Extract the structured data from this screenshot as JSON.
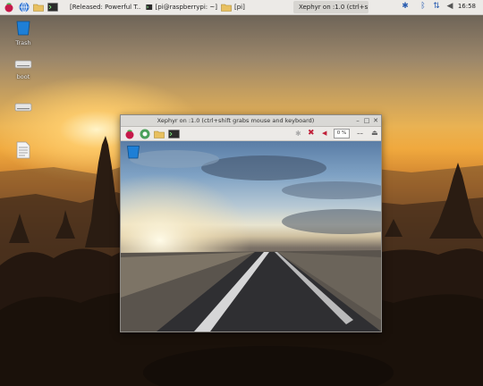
{
  "taskbar": {
    "tasks": [
      {
        "label": "[Released: Powerful T..."
      },
      {
        "label": "[pi@raspberrypi: ~]"
      },
      {
        "label": "[pi]"
      },
      {
        "label": "Xephyr on :1.0 (ctrl+s..."
      }
    ],
    "clock": "16:58"
  },
  "desktop": {
    "icons": [
      {
        "label": "Trash"
      },
      {
        "label": "boot"
      }
    ]
  },
  "xephyr": {
    "title": "Xephyr on :1.0 (ctrl+shift grabs mouse and keyboard)",
    "cpu_label": "0 %"
  },
  "colors": {
    "panel_bg": "#eceae7",
    "accent_blue": "#2a5db0",
    "trash_blue": "#1e7fd6"
  }
}
